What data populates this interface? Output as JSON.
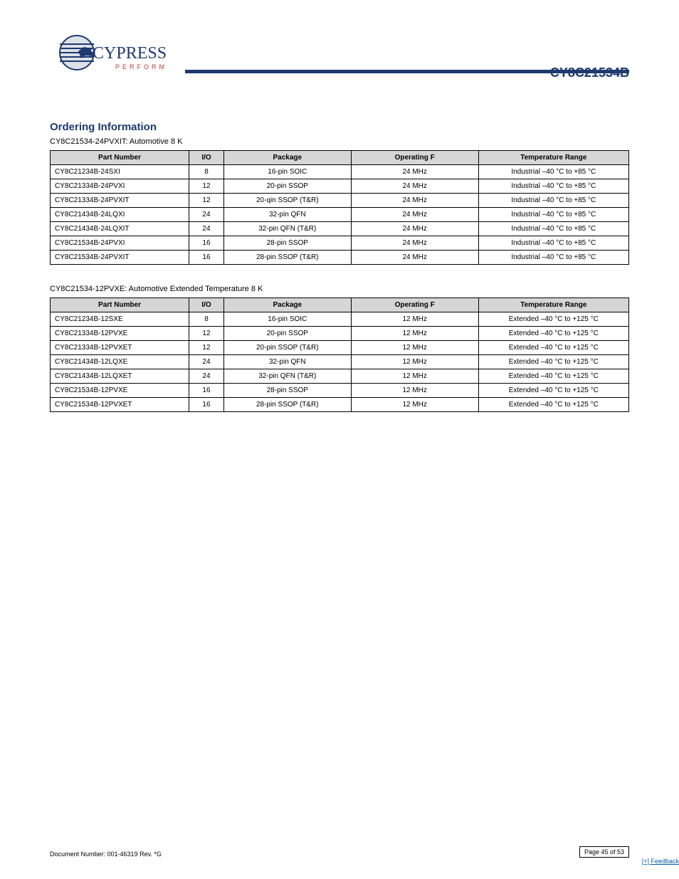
{
  "header": {
    "part_number": "CY8C21534B",
    "logo_main": "CYPRESS",
    "logo_sub": "P E R F O R M"
  },
  "section_title": "Ordering Information",
  "tables": [
    {
      "caption": "CY8C21534-24PVXIT: Automotive 8 K",
      "headers": [
        "Part Number",
        "I/O",
        "Package",
        "Operating F",
        "Temperature Range"
      ],
      "rows": [
        [
          "CY8C21234B-24SXI",
          "8",
          "16-pin SOIC",
          "24 MHz",
          "Industrial –40 °C to +85 °C"
        ],
        [
          "CY8C21334B-24PVXI",
          "12",
          "20-pin SSOP",
          "24 MHz",
          "Industrial –40 °C to +85 °C"
        ],
        [
          "CY8C21334B-24PVXIT",
          "12",
          "20-qin SSOP (T&R)",
          "24 MHz",
          "Industrial –40 °C to +85 °C"
        ],
        [
          "CY8C21434B-24LQXI",
          "24",
          "32-pin QFN",
          "24 MHz",
          "Industrial –40 °C to +85 °C"
        ],
        [
          "CY8C21434B-24LQXIT",
          "24",
          "32-pin QFN (T&R)",
          "24 MHz",
          "Industrial –40 °C to +85 °C"
        ],
        [
          "CY8C21534B-24PVXI",
          "16",
          "28-pin SSOP",
          "24 MHz",
          "Industrial –40 °C to +85 °C"
        ],
        [
          "CY8C21534B-24PVXIT",
          "16",
          "28-pin SSOP (T&R)",
          "24 MHz",
          "Industrial –40 °C to +85 °C"
        ]
      ]
    },
    {
      "caption": "CY8C21534-12PVXE: Automotive Extended Temperature 8 K",
      "headers": [
        "Part Number",
        "I/O",
        "Package",
        "Operating F",
        "Temperature Range"
      ],
      "rows": [
        [
          "CY8C21234B-12SXE",
          "8",
          "16-pin SOIC",
          "12 MHz",
          "Extended –40 °C to +125 °C"
        ],
        [
          "CY8C21334B-12PVXE",
          "12",
          "20-pin SSOP",
          "12 MHz",
          "Extended –40 °C to +125 °C"
        ],
        [
          "CY8C21334B-12PVXET",
          "12",
          "20-pin SSOP (T&R)",
          "12 MHz",
          "Extended –40 °C to +125 °C"
        ],
        [
          "CY8C21434B-12LQXE",
          "24",
          "32-pin QFN",
          "12 MHz",
          "Extended –40 °C to +125 °C"
        ],
        [
          "CY8C21434B-12LQXET",
          "24",
          "32-pin QFN (T&R)",
          "12 MHz",
          "Extended –40 °C to +125 °C"
        ],
        [
          "CY8C21534B-12PVXE",
          "16",
          "28-pin SSOP",
          "12 MHz",
          "Extended –40 °C to +125 °C"
        ],
        [
          "CY8C21534B-12PVXET",
          "16",
          "28-pin SSOP (T&R)",
          "12 MHz",
          "Extended –40 °C to +125 °C"
        ]
      ]
    }
  ],
  "footer": {
    "doc": "Document Number: 001-46319 Rev. *G",
    "page": "Page 45 of 53",
    "feedback": "[+] Feedback"
  }
}
